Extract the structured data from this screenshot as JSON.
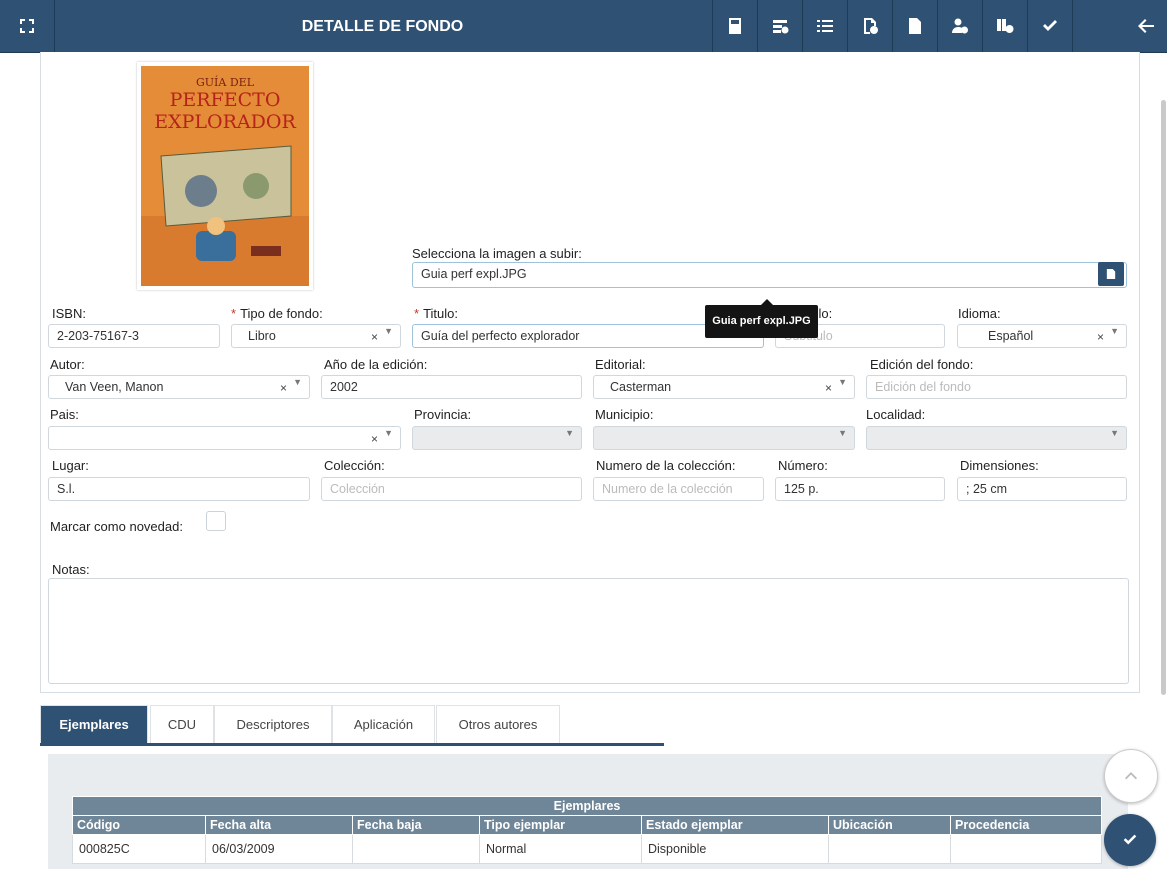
{
  "header": {
    "title": "DETALLE DE FONDO",
    "icons": [
      "expand-icon",
      "calculator-icon",
      "stats-icon",
      "list-icon",
      "file-add-icon",
      "edit-file-icon",
      "user-add-icon",
      "books-add-icon",
      "check-icon",
      "back-arrow-icon"
    ]
  },
  "cover": {
    "title_line1": "GUÍA DEL",
    "title_line2": "PERFECTO",
    "title_line3": "EXPLORADOR"
  },
  "upload": {
    "label": "Selecciona la imagen a subir:",
    "value": "Guia perf expl.JPG",
    "tooltip": "Guia perf expl.JPG"
  },
  "form": {
    "isbn": {
      "label": "ISBN:",
      "value": "2-203-75167-3"
    },
    "tipo_fondo": {
      "label": "Tipo de fondo:",
      "value": "Libro",
      "required": "*"
    },
    "titulo": {
      "label": "Titulo:",
      "value": "Guía del perfecto explorador",
      "required": "*"
    },
    "subtitulo": {
      "label": "Subtitulo:",
      "placeholder": "Subtitulo"
    },
    "idioma": {
      "label": "Idioma:",
      "value": "Español"
    },
    "autor": {
      "label": "Autor:",
      "value": "Van Veen, Manon"
    },
    "anio_edicion": {
      "label": "Año de la edición:",
      "value": "2002"
    },
    "editorial": {
      "label": "Editorial:",
      "value": "Casterman"
    },
    "edicion_fondo": {
      "label": "Edición del fondo:",
      "placeholder": "Edición del fondo"
    },
    "pais": {
      "label": "Pais:",
      "value": ""
    },
    "provincia": {
      "label": "Provincia:",
      "value": ""
    },
    "municipio": {
      "label": "Municipio:",
      "value": ""
    },
    "localidad": {
      "label": "Localidad:",
      "value": ""
    },
    "lugar": {
      "label": "Lugar:",
      "value": "S.l."
    },
    "coleccion": {
      "label": "Colección:",
      "placeholder": "Colección"
    },
    "numero_coleccion": {
      "label": "Numero de la colección:",
      "placeholder": "Numero de la colección"
    },
    "numero": {
      "label": "Número:",
      "value": "125 p."
    },
    "dimensiones": {
      "label": "Dimensiones:",
      "value": "; 25 cm"
    },
    "novedad": {
      "label": "Marcar como novedad:"
    },
    "notas": {
      "label": "Notas:",
      "value": ""
    }
  },
  "tabs": [
    {
      "label": "Ejemplares",
      "active": true
    },
    {
      "label": "CDU"
    },
    {
      "label": "Descriptores"
    },
    {
      "label": "Aplicación"
    },
    {
      "label": "Otros autores"
    }
  ],
  "ejemplares_table": {
    "caption": "Ejemplares",
    "columns": [
      "Código",
      "Fecha alta",
      "Fecha baja",
      "Tipo ejemplar",
      "Estado ejemplar",
      "Ubicación",
      "Procedencia"
    ],
    "rows": [
      [
        "000825C",
        "06/03/2009",
        "",
        "Normal",
        "Disponible",
        "",
        ""
      ]
    ]
  },
  "colors": {
    "primary": "#2f5173",
    "table_header": "#6f8699",
    "required": "#c0392b"
  }
}
